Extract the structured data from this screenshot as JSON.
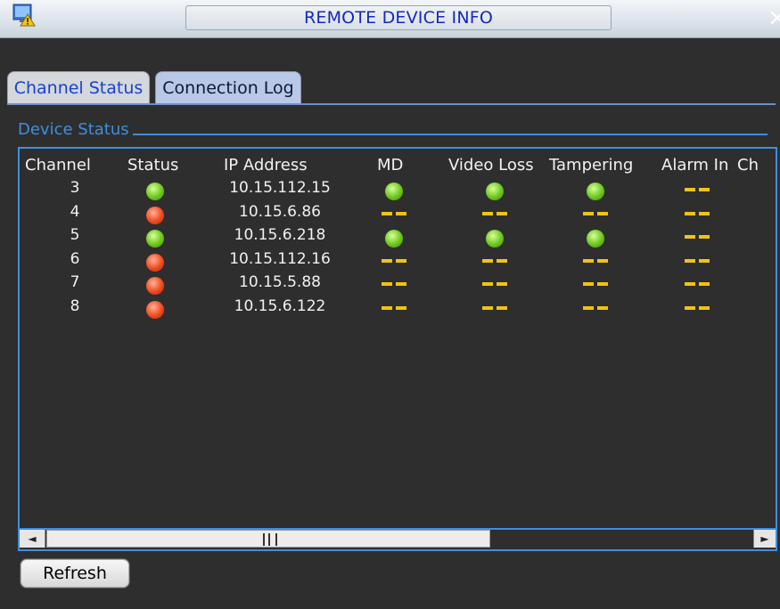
{
  "window": {
    "title": "REMOTE DEVICE INFO",
    "close_glyph": "×"
  },
  "tabs": [
    {
      "label": "Channel Status",
      "active": true
    },
    {
      "label": "Connection Log",
      "active": false
    }
  ],
  "section": {
    "label": "Device Status"
  },
  "table": {
    "columns": [
      "Channel",
      "Status",
      "IP Address",
      "MD",
      "Video Loss",
      "Tampering",
      "Alarm In",
      "Ch"
    ],
    "rows": [
      {
        "channel": "3",
        "status": "online",
        "ip": "10.15.112.15",
        "md": "online",
        "video_loss": "online",
        "tampering": "online",
        "alarm_in": "none"
      },
      {
        "channel": "4",
        "status": "offline",
        "ip": "10.15.6.86",
        "md": "none",
        "video_loss": "none",
        "tampering": "none",
        "alarm_in": "none"
      },
      {
        "channel": "5",
        "status": "online",
        "ip": "10.15.6.218",
        "md": "online",
        "video_loss": "online",
        "tampering": "online",
        "alarm_in": "none"
      },
      {
        "channel": "6",
        "status": "offline",
        "ip": "10.15.112.16",
        "md": "none",
        "video_loss": "none",
        "tampering": "none",
        "alarm_in": "none"
      },
      {
        "channel": "7",
        "status": "offline",
        "ip": "10.15.5.88",
        "md": "none",
        "video_loss": "none",
        "tampering": "none",
        "alarm_in": "none"
      },
      {
        "channel": "8",
        "status": "offline",
        "ip": "10.15.6.122",
        "md": "none",
        "video_loss": "none",
        "tampering": "none",
        "alarm_in": "none"
      }
    ]
  },
  "scrollbar": {
    "left_arrow": "◄",
    "right_arrow": "►"
  },
  "buttons": {
    "refresh": "Refresh"
  },
  "colors": {
    "online": "#6cc61c",
    "offline": "#f04a1e",
    "none_dash": "#f2c410",
    "accent": "#3c8fe2"
  },
  "icons": {
    "app": "monitor-warning-icon",
    "close": "close-icon"
  }
}
